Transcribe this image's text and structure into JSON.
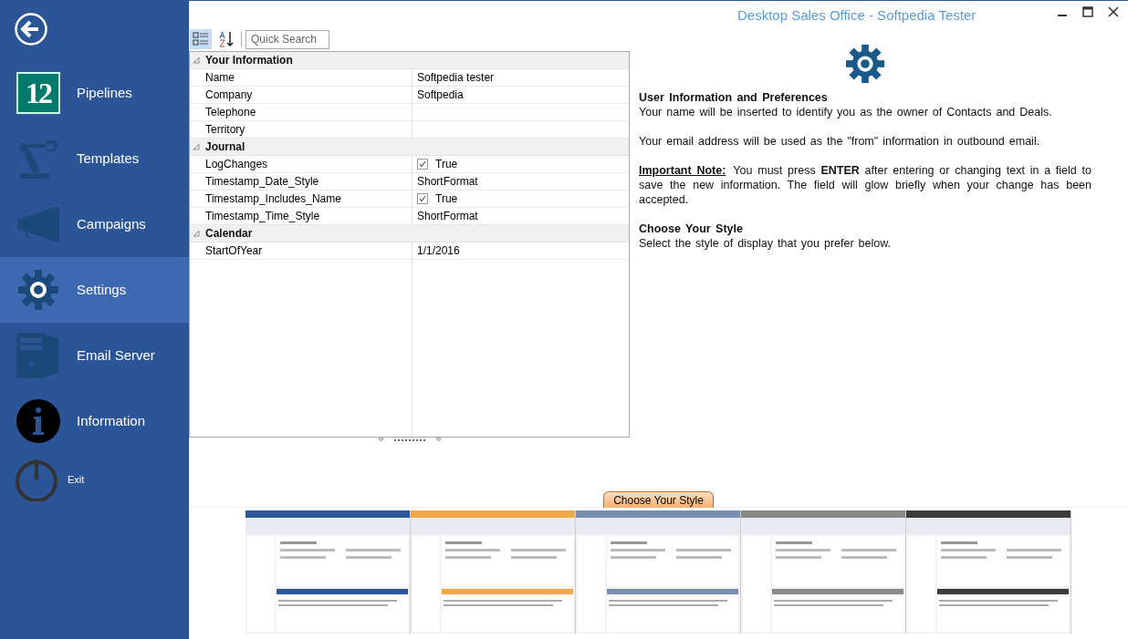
{
  "window": {
    "title": "Desktop Sales Office - Softpedia Tester"
  },
  "sidebar": {
    "items": [
      {
        "kind": "calendar",
        "badge": "12",
        "label": "Pipelines",
        "selected": false
      },
      {
        "kind": "robot-arm",
        "label": "Templates",
        "selected": false
      },
      {
        "kind": "megaphone",
        "label": "Campaigns",
        "selected": false
      },
      {
        "kind": "gear",
        "label": "Settings",
        "selected": true
      },
      {
        "kind": "server",
        "label": "Email Server",
        "selected": false
      },
      {
        "kind": "info",
        "label": "Information",
        "selected": false
      }
    ],
    "exit": "Exit"
  },
  "property_grid": {
    "toolbar": [
      {
        "kind": "categorized",
        "selected": true
      },
      {
        "kind": "alphabetical",
        "selected": false
      }
    ],
    "search": {
      "placeholder": "Quick Search"
    },
    "categories": [
      {
        "name": "Your Information",
        "expanded": true,
        "rows": [
          {
            "name": "Name",
            "value": "Softpedia tester"
          },
          {
            "name": "Company",
            "value": "Softpedia"
          },
          {
            "name": "Telephone"
          },
          {
            "name": "Territory"
          }
        ]
      },
      {
        "name": "Journal",
        "expanded": true,
        "rows": [
          {
            "name": "LogChanges",
            "kind": "checkbox",
            "checked": true,
            "value": "True"
          },
          {
            "name": "Timestamp_Date_Style",
            "value": "ShortFormat"
          },
          {
            "name": "Timestamp_Includes_Name",
            "kind": "checkbox",
            "checked": true,
            "value": "True"
          },
          {
            "name": "Timestamp_Time_Style",
            "value": "ShortFormat"
          }
        ]
      },
      {
        "name": "Calendar",
        "expanded": true,
        "rows": [
          {
            "name": "StartOfYear",
            "value": "1/1/2016"
          }
        ]
      }
    ]
  },
  "info": {
    "heading": "User Information and Preferences",
    "paragraphs": [
      "Your name will be inserted to identify you as the owner of Contacts and Deals.",
      "Your email address will be used as the \"from\" information in outbound email."
    ],
    "note": {
      "label": "Important Note:",
      "text": "You must press **ENTER** after entering or changing text in a field to save the new information. The field will glow briefly when your change has been accepted."
    },
    "style_heading": "Choose Your Style",
    "style_text": "Select the style of display that you prefer below."
  },
  "style_picker": {
    "tab": "Choose Your Style",
    "styles": [
      {
        "color": "#2b579a"
      },
      {
        "color": "#f0a848"
      },
      {
        "color": "#7a8fb0"
      },
      {
        "color": "#8a8a8a"
      },
      {
        "color": "#3c3c3c"
      }
    ]
  }
}
